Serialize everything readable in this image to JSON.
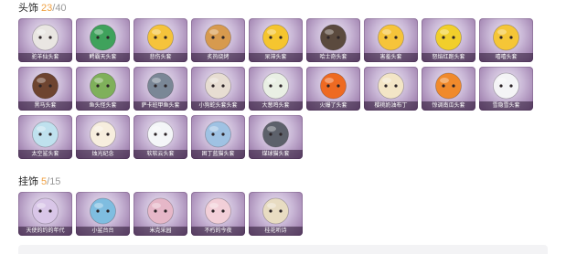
{
  "headwear": {
    "title": "头饰",
    "count": "23",
    "total": "40",
    "items": [
      {
        "label": "驼羊仙头套",
        "icon": "raccoon-sunglasses-icon",
        "color": "#e9e6e2"
      },
      {
        "label": "鳄霸天头套",
        "icon": "green-crocodile-icon",
        "color": "#3fa25c"
      },
      {
        "label": "悲伤头套",
        "icon": "sad-face-icon",
        "color": "#f5c33b"
      },
      {
        "label": "炙热烧烤",
        "icon": "toast-bread-icon",
        "color": "#d79a4e"
      },
      {
        "label": "呆滞头套",
        "icon": "dazed-face-icon",
        "color": "#f5c52f"
      },
      {
        "label": "哈士奇头套",
        "icon": "husky-dog-icon",
        "color": "#5b4a3e"
      },
      {
        "label": "害羞头套",
        "icon": "shy-face-icon",
        "color": "#f6c43a"
      },
      {
        "label": "怒焰红跑头套",
        "icon": "sunglasses-pikachu-icon",
        "color": "#f1cf2b"
      },
      {
        "label": "嘻嘻头套",
        "icon": "grin-face-icon",
        "color": "#f5c637"
      },
      {
        "label": "黑马头套",
        "icon": "brown-horse-icon",
        "color": "#6e4430"
      },
      {
        "label": "鱼头怪头套",
        "icon": "fish-head-icon",
        "color": "#7fb05b"
      },
      {
        "label": "萨卡班甲鱼头套",
        "icon": "grey-fish-icon",
        "color": "#7a8796"
      },
      {
        "label": "小狗蛇头套头套",
        "icon": "cute-snake-icon",
        "color": "#e7ddd2"
      },
      {
        "label": "大葱鸡头套",
        "icon": "scallion-head-icon",
        "color": "#e9efe4"
      },
      {
        "label": "火爆了头套",
        "icon": "fire-spirit-icon",
        "color": "#ee6a22"
      },
      {
        "label": "樱桃奶油布丁",
        "icon": "pudding-icon",
        "color": "#f3e5c6"
      },
      {
        "label": "惊调南瓜头套",
        "icon": "pumpkin-icon",
        "color": "#f08a2c"
      },
      {
        "label": "雪隐雪头套",
        "icon": "snowman-icon",
        "color": "#f4f4f6"
      },
      {
        "label": "太空鲨头套",
        "icon": "space-shark-icon",
        "color": "#bfe1ee"
      },
      {
        "label": "烛光纪念",
        "icon": "candle-icon",
        "color": "#f7eede"
      },
      {
        "label": "软软云头套",
        "icon": "cloud-icon",
        "color": "#f4f6f8"
      },
      {
        "label": "困丁蓝猫头套",
        "icon": "blue-bird-icon",
        "color": "#9fc2e3"
      },
      {
        "label": "煤球猫头套",
        "icon": "grey-cat-icon",
        "color": "#5d616b"
      }
    ]
  },
  "pendants": {
    "title": "挂饰",
    "count": "5",
    "total": "15",
    "items": [
      {
        "label": "天使的约的年代",
        "icon": "feather-charm-icon",
        "color": "#d9c6e8"
      },
      {
        "label": "小鲨台台",
        "icon": "shark-charm-icon",
        "color": "#7fbde0"
      },
      {
        "label": "米克采园",
        "icon": "girl-doll-icon",
        "color": "#e6b7c8"
      },
      {
        "label": "不朽的今夜",
        "icon": "bunny-charm-icon",
        "color": "#f2cfd8"
      },
      {
        "label": "桂花听诗",
        "icon": "fairy-charm-icon",
        "color": "#e8dcc2"
      }
    ]
  }
}
